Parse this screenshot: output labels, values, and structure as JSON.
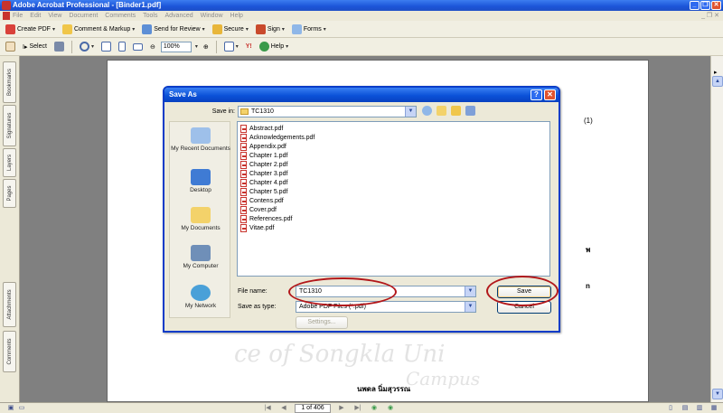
{
  "window": {
    "title": "Adobe Acrobat Professional - [Binder1.pdf]"
  },
  "menu": [
    "File",
    "Edit",
    "View",
    "Document",
    "Comments",
    "Tools",
    "Advanced",
    "Window",
    "Help"
  ],
  "toolbar1": {
    "create_pdf": "Create PDF",
    "comment_markup": "Comment & Markup",
    "send_review": "Send for Review",
    "secure": "Secure",
    "sign": "Sign",
    "forms": "Forms"
  },
  "toolbar2": {
    "select": "Select",
    "zoom_level": "100%",
    "help": "Help"
  },
  "left_tabs": [
    "Bookmarks",
    "Signatures",
    "Layers",
    "Pages",
    "Attachments",
    "Comments"
  ],
  "page": {
    "page_number_label": "(1)",
    "thai_char_1": "พ",
    "thai_char_2": "n",
    "author_name": "นพดล  นิ่มสุวรรณ",
    "watermark_1": "ce of Songkla Uni",
    "watermark_2": "Campus"
  },
  "status": {
    "page_indicator": "1 of 406"
  },
  "dialog": {
    "title": "Save As",
    "save_in_label": "Save in:",
    "save_in_value": "TC1310",
    "places": [
      "My Recent Documents",
      "Desktop",
      "My Documents",
      "My Computer",
      "My Network"
    ],
    "files": [
      "Abstract.pdf",
      "Acknowledgements.pdf",
      "Appendix.pdf",
      "Chapter 1.pdf",
      "Chapter 2.pdf",
      "Chapter 3.pdf",
      "Chapter 4.pdf",
      "Chapter 5.pdf",
      "Contens.pdf",
      "Cover.pdf",
      "References.pdf",
      "Vitae.pdf"
    ],
    "file_name_label": "File name:",
    "file_name_value": "TC1310",
    "save_as_type_label": "Save as type:",
    "save_as_type_value": "Adobe PDF Files (*.pdf)",
    "settings_button": "Settings...",
    "save_button": "Save",
    "cancel_button": "Cancel"
  },
  "colors": {
    "title_blue": "#0b52d8",
    "annotation_red": "#b2171a",
    "acrobat_red": "#c8332d"
  }
}
